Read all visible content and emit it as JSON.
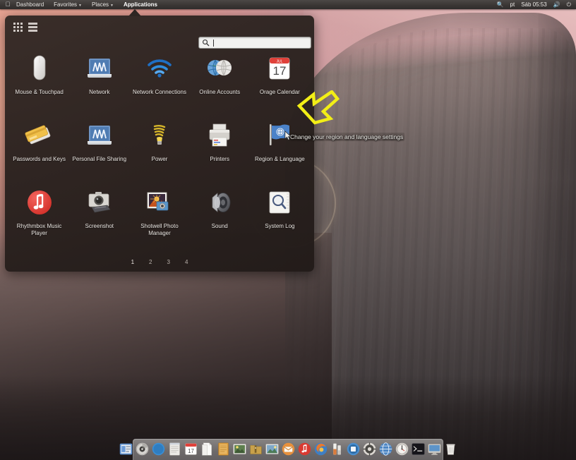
{
  "topbar": {
    "apple_logo": "apple-logo",
    "menus": [
      {
        "label": "Dashboard",
        "bold": false,
        "caret": false
      },
      {
        "label": "Favorites",
        "bold": false,
        "caret": true
      },
      {
        "label": "Places",
        "bold": false,
        "caret": true
      },
      {
        "label": "Applications",
        "bold": true,
        "caret": false
      }
    ],
    "search_icon": "search-icon",
    "language": "pt",
    "clock": "Sáb 05:53",
    "volume_icon": "volume-icon",
    "power_icon": "power-icon"
  },
  "launcher": {
    "view_grid_icon": "grid-view-icon",
    "view_list_icon": "list-view-icon",
    "search": {
      "icon": "search-icon",
      "value": "",
      "placeholder": ""
    },
    "apps": [
      {
        "label": "Mouse & Touchpad",
        "icon": "mouse-icon"
      },
      {
        "label": "Network",
        "icon": "network-icon"
      },
      {
        "label": "Network Connections",
        "icon": "wifi-icon"
      },
      {
        "label": "Online Accounts",
        "icon": "online-accounts-icon"
      },
      {
        "label": "Orage Calendar",
        "icon": "calendar-icon"
      },
      {
        "label": "Passwords and Keys",
        "icon": "passwords-keys-icon"
      },
      {
        "label": "Personal File Sharing",
        "icon": "file-sharing-icon"
      },
      {
        "label": "Power",
        "icon": "lightbulb-icon"
      },
      {
        "label": "Printers",
        "icon": "printer-icon"
      },
      {
        "label": "Region & Language",
        "icon": "flag-icon"
      },
      {
        "label": "Rhythmbox Music Player",
        "icon": "rhythmbox-icon"
      },
      {
        "label": "Screenshot",
        "icon": "screenshot-icon"
      },
      {
        "label": "Shotwell Photo Manager",
        "icon": "shotwell-icon"
      },
      {
        "label": "Sound",
        "icon": "speaker-icon"
      },
      {
        "label": "System Log",
        "icon": "system-log-icon"
      }
    ],
    "pages": [
      {
        "label": "1",
        "active": true
      },
      {
        "label": "2",
        "active": false
      },
      {
        "label": "3",
        "active": false
      },
      {
        "label": "4",
        "active": false
      }
    ]
  },
  "tooltip": {
    "text": "Change your region and language settings"
  },
  "annotation": {
    "arrow_color": "#f2ee16",
    "arrow_name": "highlight-arrow"
  },
  "calendar_icon": {
    "month": "JUL",
    "day": "17"
  },
  "dock": {
    "items": [
      {
        "name": "files-icon"
      },
      {
        "name": "disk-utility-icon"
      },
      {
        "name": "safari-icon"
      },
      {
        "name": "notes-icon"
      },
      {
        "name": "calendar-icon"
      },
      {
        "name": "documents-icon"
      },
      {
        "name": "text-editor-icon"
      },
      {
        "name": "photo-icon"
      },
      {
        "name": "archive-manager-icon"
      },
      {
        "name": "image-viewer-icon"
      },
      {
        "name": "mail-icon"
      },
      {
        "name": "rhythmbox-icon"
      },
      {
        "name": "firefox-icon"
      },
      {
        "name": "drinks-icon"
      },
      {
        "name": "media-player-icon"
      },
      {
        "name": "settings-icon"
      },
      {
        "name": "browser-icon"
      },
      {
        "name": "system-monitor-icon"
      },
      {
        "name": "terminal-icon"
      },
      {
        "name": "display-icon"
      },
      {
        "name": "trash-icon"
      }
    ]
  },
  "colors": {
    "panel_bg": "#2c2320",
    "topbar_bg": "#3b3735",
    "accent_yellow": "#f2ee16",
    "label_text": "#e9e5e1"
  }
}
